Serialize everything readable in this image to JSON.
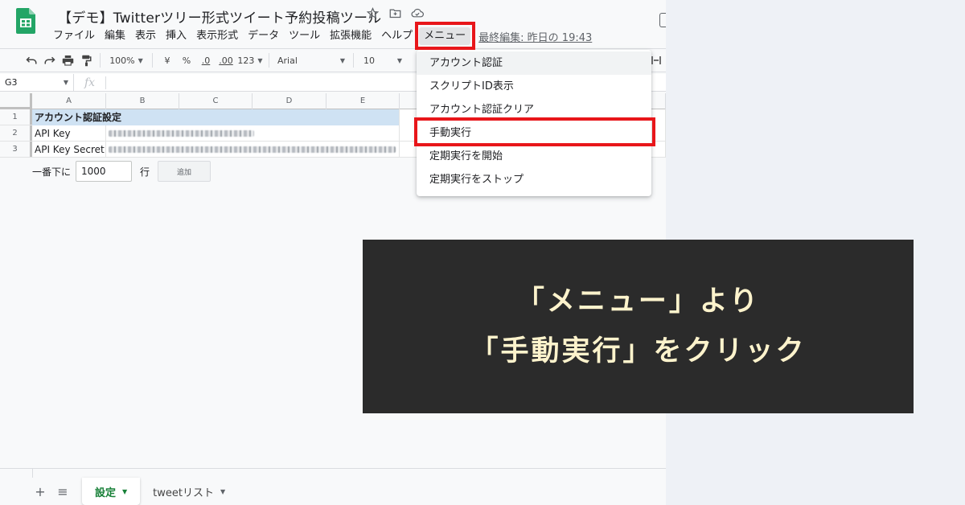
{
  "app": {
    "doc_title": "【デモ】Twitterツリー形式ツイート予約投稿ツール",
    "last_edit": "最終編集: 昨日の 19:43",
    "menus": [
      "ファイル",
      "編集",
      "表示",
      "挿入",
      "表示形式",
      "データ",
      "ツール",
      "拡張機能",
      "ヘルプ"
    ],
    "custom_menu": "メニュー"
  },
  "toolbar": {
    "zoom": "100%",
    "currency": "¥",
    "percent": "%",
    "dec_decrease": ".0",
    "dec_increase": ".00",
    "format_more": "123",
    "font": "Arial",
    "font_size": "10"
  },
  "formula": {
    "cell_ref": "G3",
    "fx": "fx"
  },
  "grid": {
    "columns": [
      "A",
      "B",
      "C",
      "D",
      "E"
    ],
    "rows": [
      {
        "num": "1",
        "a": "アカウント認証設定",
        "b": ""
      },
      {
        "num": "2",
        "a": "API Key",
        "b": ""
      },
      {
        "num": "3",
        "a": "API Key Secret",
        "b": ""
      }
    ],
    "add_label": "一番下に",
    "add_value": "1000",
    "add_suffix": "行",
    "add_button": "追加"
  },
  "dropdown": {
    "items": [
      "アカウント認証",
      "スクリプトID表示",
      "アカウント認証クリア",
      "手動実行",
      "定期実行を開始",
      "定期実行をストップ"
    ]
  },
  "sheets": {
    "active": "設定",
    "other": "tweetリスト"
  },
  "caption": {
    "line1": "「メニュー」より",
    "line2": "「手動実行」をクリック"
  },
  "colors": {
    "highlight": "#e8161a",
    "caption_bg": "#2b2b2b",
    "caption_text": "#fdf3cc",
    "sheets_green": "#188038"
  }
}
